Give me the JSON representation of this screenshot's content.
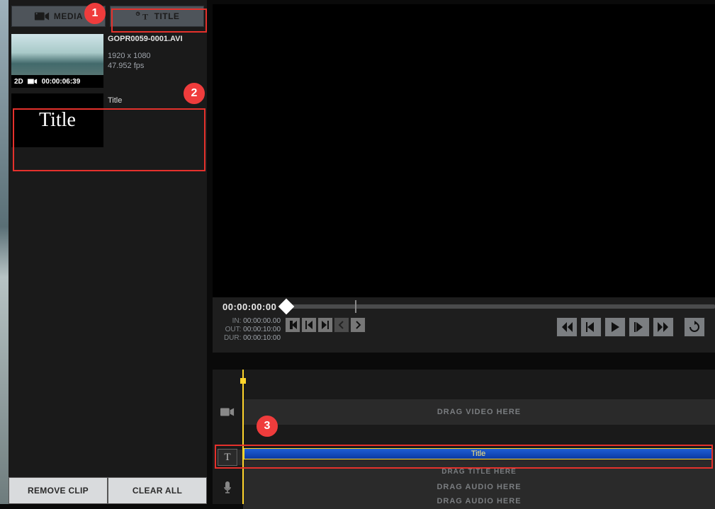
{
  "tabs": {
    "media": "MEDIA",
    "title": "TITLE"
  },
  "media_item": {
    "filename": "GOPR0059-0001.AVI",
    "badge_mode": "2D",
    "badge_time": "00:00:06:39",
    "resolution": "1920 x 1080",
    "fps": "47.952 fps"
  },
  "title_item": {
    "thumb_text": "Title",
    "label": "Title"
  },
  "left_buttons": {
    "remove": "REMOVE CLIP",
    "clear": "CLEAR ALL"
  },
  "transport": {
    "main_timecode": "00:00:00:00",
    "in_label": "IN:",
    "in_val": "00:00:00.00",
    "out_label": "OUT:",
    "out_val": "00:00:10:00",
    "dur_label": "DUR:",
    "dur_val": "00:00:10:00"
  },
  "timeline": {
    "video_placeholder": "DRAG VIDEO HERE",
    "title_clip_label": "Title",
    "title_placeholder": "DRAG TITLE HERE",
    "audio_placeholder": "DRAG AUDIO HERE"
  },
  "callouts": {
    "c1": "1",
    "c2": "2",
    "c3": "3"
  }
}
